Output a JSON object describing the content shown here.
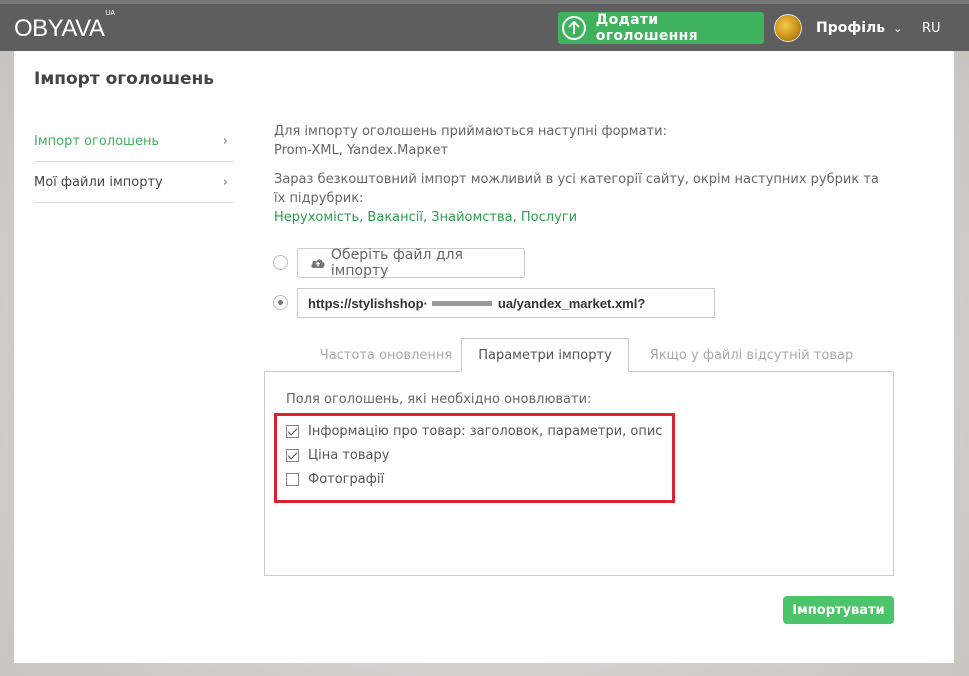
{
  "header": {
    "logo": "OBYAVA",
    "logo_suffix": "UA",
    "add_button": "Додати оголошення",
    "profile": "Профіль",
    "lang": "RU"
  },
  "page_title": "Імпорт оголошень",
  "sidebar": {
    "items": [
      {
        "label": "Імпорт оголошень",
        "active": true
      },
      {
        "label": "Мої файли імпорту",
        "active": false
      }
    ]
  },
  "info": {
    "formats_line1": "Для імпорту оголошень приймаються наступні формати:",
    "formats_line2": "Prom-XML, Yandex.Маркет",
    "free_line1": "Зараз безкоштовний імпорт можливий в усі категорії сайту, окрім наступних рубрик та",
    "free_line2": "їх підрубрик:",
    "excluded": "Нерухомість, Вакансії, Знайомства, Послуги"
  },
  "source": {
    "file_button": "Оберіть файл для імпорту",
    "url_prefix": "https://stylishshop·",
    "url_suffix": "ua/yandex_market.xml?",
    "selected": "url"
  },
  "tabs": [
    {
      "label": "Частота оновлення",
      "active": false
    },
    {
      "label": "Параметри імпорту",
      "active": true
    },
    {
      "label": "Якщо у файлі відсутній товар",
      "active": false
    }
  ],
  "params": {
    "fields_label": "Поля оголошень, які необхідно оновлювати:",
    "checkboxes": [
      {
        "label": "Інформацію про товар: заголовок, параметри, опис",
        "checked": true
      },
      {
        "label": "Ціна товару",
        "checked": true
      },
      {
        "label": "Фотографії",
        "checked": false
      }
    ]
  },
  "import_button": "Імпортувати",
  "colors": {
    "accent": "#3fb25e",
    "topbar": "#5e5e5e",
    "highlight": "#d9232d"
  }
}
